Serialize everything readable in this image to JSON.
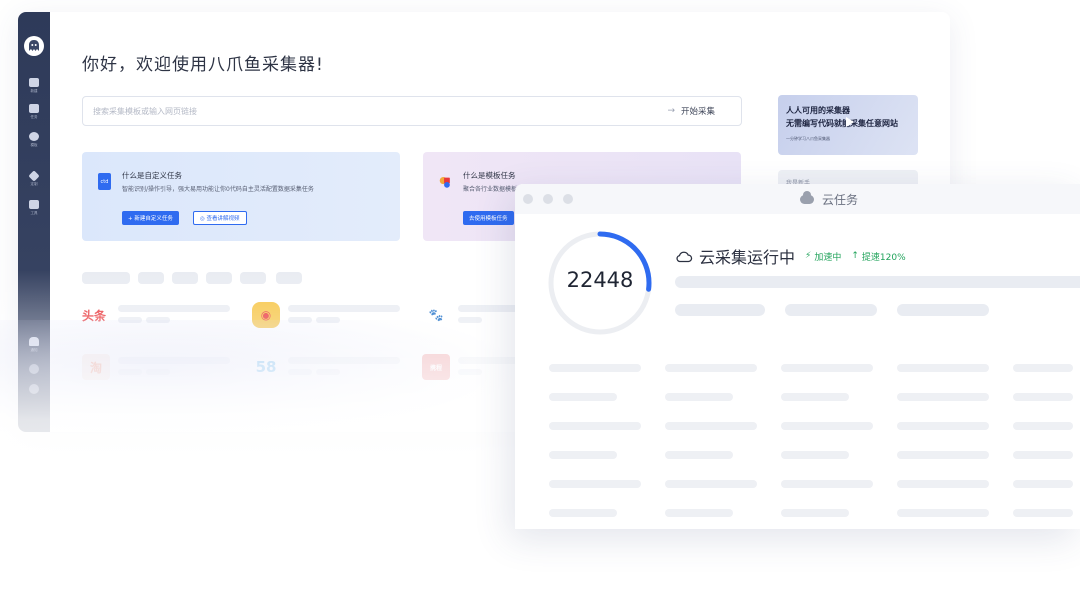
{
  "sidebar": {
    "items": [
      {
        "label": "新建",
        "icon": "plus-square-icon"
      },
      {
        "label": "任务",
        "icon": "bookmark-icon"
      },
      {
        "label": "模板",
        "icon": "gear-icon"
      },
      {
        "label": "定制",
        "icon": "diamond-icon"
      },
      {
        "label": "工具",
        "icon": "toolbox-icon"
      }
    ],
    "bottom_items": [
      {
        "label": "通知",
        "icon": "bell-icon"
      }
    ]
  },
  "main": {
    "headline": "你好，欢迎使用八爪鱼采集器!",
    "search": {
      "placeholder": "搜索采集模板或输入网页链接",
      "button_label": "开始采集",
      "button_icon": "arrow-right-icon"
    },
    "cards": [
      {
        "title": "什么是自定义任务",
        "description": "智能识别/操作引导，强大易用功能让你0代码自主灵活配置数据采集任务",
        "buttons": [
          "+ 新建自定义任务",
          "◎ 查看讲解视频"
        ]
      },
      {
        "title": "什么是模板任务",
        "description": "聚合各行业数据模板",
        "buttons": [
          "去使用模板任务"
        ]
      }
    ],
    "sites": [
      {
        "name": "头条",
        "color": "#e8373b"
      },
      {
        "name": "微博",
        "color": "#f2a93b"
      },
      {
        "name": "百度",
        "color": "#2f6bf0"
      },
      {
        "name": "淘",
        "color": "#f2683a"
      },
      {
        "name": "58",
        "color": "#3fa7e8"
      },
      {
        "name": "携程",
        "color": "#e8373b"
      }
    ],
    "promo": {
      "line1": "人人可用的采集器",
      "line2": "无需编写代码就能采集任意网站",
      "line3": "一分钟学习八爪鱼采集器"
    },
    "side_panel_label": "我是新手"
  },
  "cloud_window": {
    "title": "云任务",
    "count": "22448",
    "progress": 0.27,
    "status": "云采集运行中",
    "badges": [
      {
        "icon": "lightning-icon",
        "text": "加速中"
      },
      {
        "icon": "arrow-up-icon",
        "text": "提速120%"
      }
    ],
    "colors": {
      "accent": "#2f6bf0",
      "ok": "#21a35b"
    }
  }
}
